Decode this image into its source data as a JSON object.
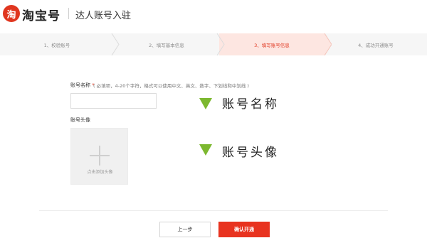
{
  "header": {
    "logo_mark": "淘",
    "logo_text": "淘宝号",
    "page_title": "达人账号入驻"
  },
  "steps": [
    {
      "label": "1、校验账号",
      "state": "done"
    },
    {
      "label": "2、填写基本信息",
      "state": "done"
    },
    {
      "label": "3、填写账号信息",
      "state": "active"
    },
    {
      "label": "4、成功开通账号",
      "state": "todo"
    }
  ],
  "form": {
    "name_label": "账号名称",
    "name_required_mark": "*",
    "name_hint": "( 必填项，4-20个字符，格式可以使用中文、英文、数字、下划线和中划线 )",
    "name_value": "",
    "avatar_label": "账号头像",
    "avatar_upload_text": "点击添加头像"
  },
  "annotations": {
    "name_note": "账号名称",
    "avatar_note": "账号头像"
  },
  "buttons": {
    "prev": "上一步",
    "confirm": "确认开通"
  },
  "colors": {
    "brand_red": "#e0361f",
    "active_step_bg": "#fde6e1",
    "annotation_green": "#7cb82f"
  }
}
